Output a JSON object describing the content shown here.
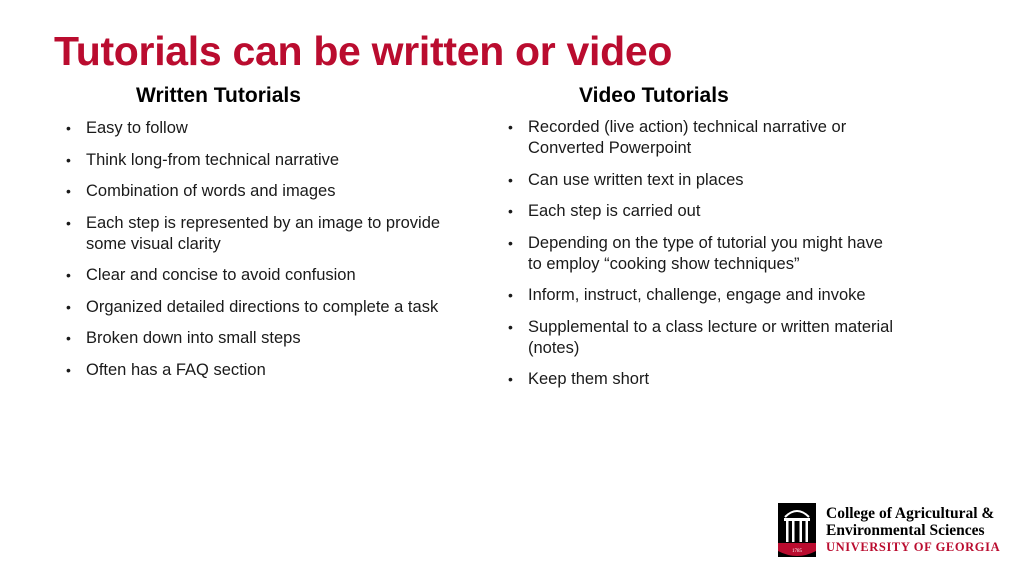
{
  "slide": {
    "title": "Tutorials can be written or video",
    "accent_color": "#ba0c2f"
  },
  "written": {
    "heading": "Written Tutorials",
    "items": [
      "Easy to follow",
      "Think long-from technical narrative",
      "Combination of words and images",
      "Each step is represented by an image to provide some visual clarity",
      "Clear and concise to avoid confusion",
      "Organized detailed directions to complete a task",
      "Broken down into small steps",
      "Often has a FAQ section"
    ]
  },
  "video": {
    "heading": "Video Tutorials",
    "items": [
      "Recorded (live action) technical narrative  or Converted Powerpoint",
      "Can use written text in places",
      "Each step is carried out",
      "Depending on the type of tutorial you might have to employ “cooking show techniques”",
      "Inform, instruct, challenge, engage and invoke",
      "Supplemental to a class lecture or written material (notes)",
      "Keep them short"
    ]
  },
  "logo": {
    "line1": "College of Agricultural &",
    "line2": "Environmental Sciences",
    "university": "UNIVERSITY OF GEORGIA",
    "year": "1785",
    "icon": "arch-icon"
  },
  "bullet_glyph": "•"
}
